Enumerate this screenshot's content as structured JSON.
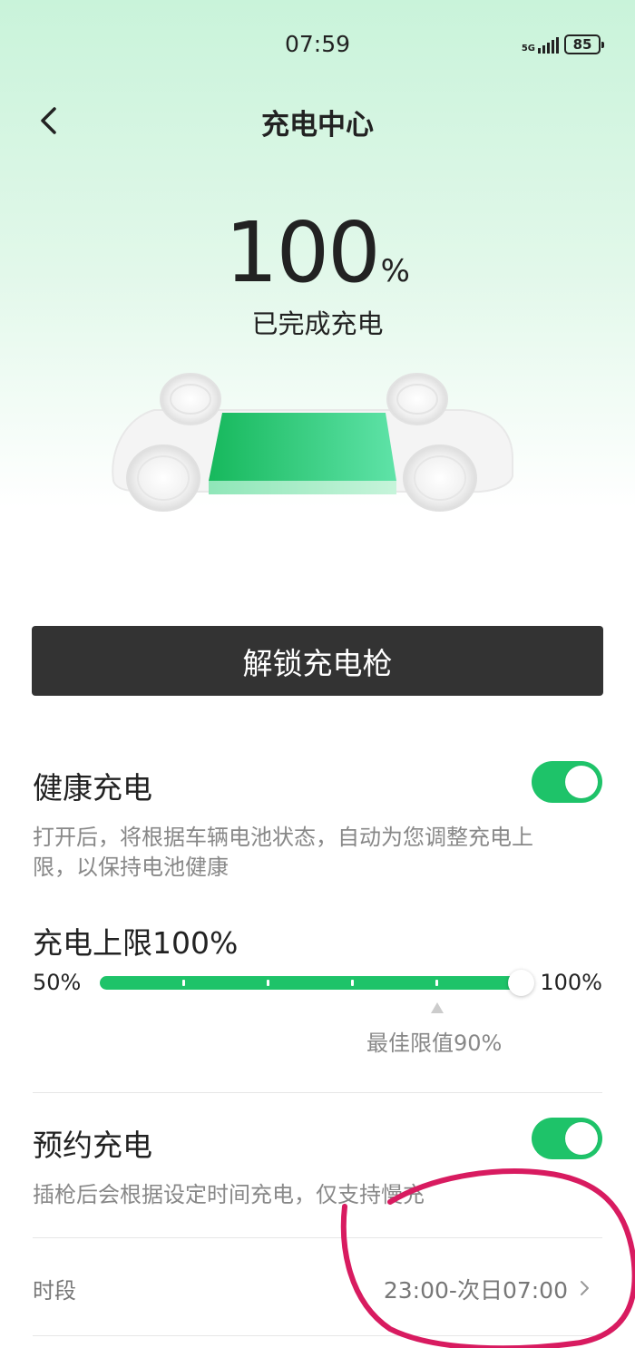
{
  "status_bar": {
    "time": "07:59",
    "network": "5G",
    "battery": "85"
  },
  "header": {
    "title": "充电中心"
  },
  "charge": {
    "percent": "100",
    "percent_symbol": "%",
    "status": "已完成充电"
  },
  "actions": {
    "unlock_label": "解锁充电枪"
  },
  "healthy_charging": {
    "title": "健康充电",
    "enabled": true,
    "description": "打开后，将根据车辆电池状态，自动为您调整充电上限，以保持电池健康"
  },
  "charge_limit": {
    "title": "充电上限100%",
    "min_label": "50%",
    "max_label": "100%",
    "value_percent": 100,
    "best_label": "最佳限值90%"
  },
  "scheduled_charging": {
    "title": "预约充电",
    "enabled": true,
    "description": "插枪后会根据设定时间充电，仅支持慢充",
    "period_label": "时段",
    "period_value": "23:00-次日07:00"
  },
  "colors": {
    "accent": "#1ec369",
    "button_dark": "#333333",
    "annotation": "#d81b60"
  },
  "icons": {
    "back": "back-arrow-icon",
    "chevron": "chevron-right-icon"
  }
}
